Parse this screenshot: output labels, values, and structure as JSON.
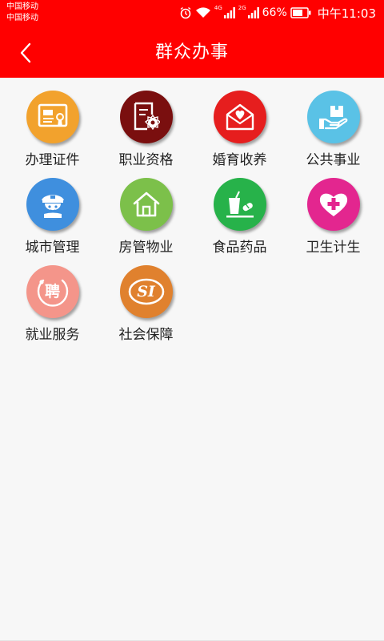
{
  "status_bar": {
    "carrier_1": "中国移动",
    "carrier_2": "中国移动",
    "net_tag_1": "4G",
    "net_tag_2": "2G",
    "battery": "66%",
    "time": "中午11:03"
  },
  "header": {
    "title": "群众办事",
    "background_color": "#ff0000"
  },
  "services": [
    {
      "label": "办理证件",
      "icon": "certificate-icon",
      "color": "#f2a22d"
    },
    {
      "label": "职业资格",
      "icon": "qualification-icon",
      "color": "#7a0f0f"
    },
    {
      "label": "婚育收养",
      "icon": "envelope-heart-icon",
      "color": "#e61e1e"
    },
    {
      "label": "公共事业",
      "icon": "hand-box-icon",
      "color": "#5ac2e6"
    },
    {
      "label": "城市管理",
      "icon": "officer-icon",
      "color": "#3f8fde"
    },
    {
      "label": "房管物业",
      "icon": "house-icon",
      "color": "#7cc04a"
    },
    {
      "label": "食品药品",
      "icon": "food-drug-icon",
      "color": "#27b24a"
    },
    {
      "label": "卫生计生",
      "icon": "medical-heart-icon",
      "color": "#e3268f"
    },
    {
      "label": "就业服务",
      "icon": "hire-icon",
      "color": "#f4958a",
      "glyph": "聘"
    },
    {
      "label": "社会保障",
      "icon": "social-insurance-icon",
      "color": "#e0812e",
      "glyph": "SI"
    }
  ]
}
